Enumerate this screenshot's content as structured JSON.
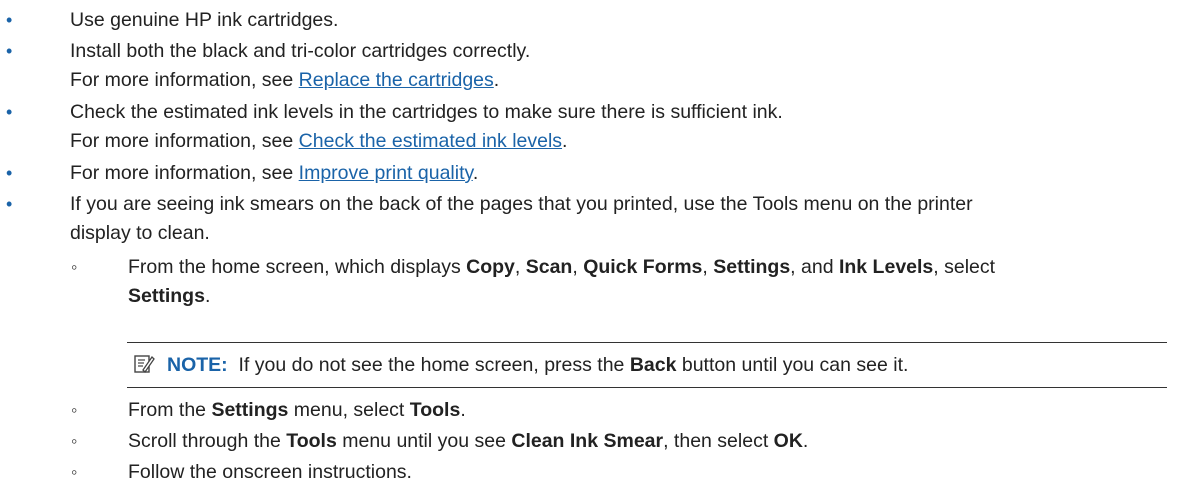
{
  "bullets": {
    "b1": "Use genuine HP ink cartridges.",
    "b2": "Install both the black and tri-color cartridges correctly.",
    "b2_more_prefix": "For more information, see ",
    "b2_link": "Replace the cartridges",
    "b3": "Check the estimated ink levels in the cartridges to make sure there is sufficient ink.",
    "b3_more_prefix": "For more information, see ",
    "b3_link": "Check the estimated ink levels",
    "b4_prefix": "For more information, see ",
    "b4_link": "Improve print quality",
    "b5_line1": "If you are seeing ink smears on the back of the pages that you printed, use the Tools menu on the printer",
    "b5_line2": "display to clean.",
    "period": "."
  },
  "sub": {
    "s1_t1": "From the home screen, which displays ",
    "s1_copy": "Copy",
    "s1_sep": ", ",
    "s1_scan": "Scan",
    "s1_quick": "Quick Forms",
    "s1_settings": "Settings",
    "s1_and": ", and ",
    "s1_ink": "Ink Levels",
    "s1_select": ", select",
    "s1_settings2": "Settings",
    "s2_t1": "From the ",
    "s2_settings": "Settings",
    "s2_t2": " menu, select ",
    "s2_tools": "Tools",
    "s3_t1": "Scroll through the ",
    "s3_tools": "Tools",
    "s3_t2": " menu until you see ",
    "s3_clean": "Clean Ink Smear",
    "s3_t3": ", then select ",
    "s3_ok": "OK",
    "s4": "Follow the onscreen instructions."
  },
  "note": {
    "label": "NOTE:",
    "t1": "  If you do not see the home screen, press the ",
    "back": "Back",
    "t2": " button until you can see it.",
    "icon": "note-icon"
  },
  "symbols": {
    "bullet": "•",
    "sub_bullet": "◦"
  },
  "colors": {
    "link": "#1a63a8",
    "bullet": "#1a63a8",
    "text": "#222222"
  }
}
